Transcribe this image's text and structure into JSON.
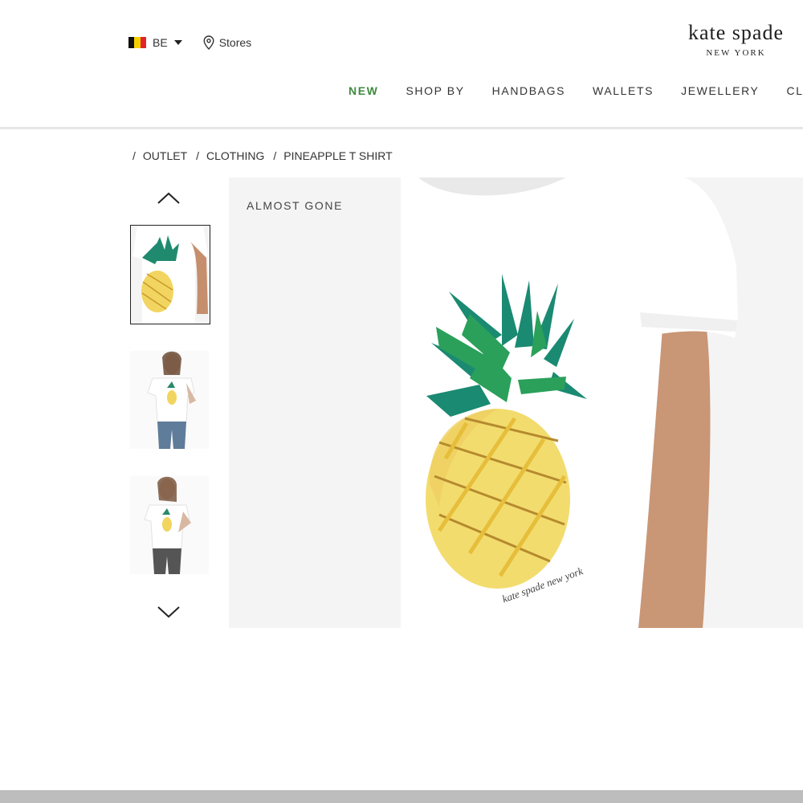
{
  "header": {
    "locale": {
      "code": "BE",
      "flag_colors": [
        "#111111",
        "#f5d000",
        "#e3232c"
      ]
    },
    "stores_label": "Stores",
    "logo": {
      "line1": "kate spade",
      "line2": "NEW YORK"
    },
    "nav": [
      {
        "label": "NEW",
        "highlight": true
      },
      {
        "label": "SHOP BY"
      },
      {
        "label": "HANDBAGS"
      },
      {
        "label": "WALLETS"
      },
      {
        "label": "JEWELLERY"
      },
      {
        "label": "CLOT"
      }
    ],
    "accent_color": "#3f8a3f"
  },
  "breadcrumb": [
    "OUTLET",
    "CLOTHING",
    "PINEAPPLE T SHIRT"
  ],
  "gallery": {
    "up_icon": "chevron-up-icon",
    "down_icon": "chevron-down-icon",
    "selected_index": 0,
    "thumbnails": [
      "thumbnail-front-view",
      "thumbnail-model-full",
      "thumbnail-model-pose"
    ]
  },
  "product": {
    "badge": "ALMOST GONE",
    "print_signature": "kate spade new york"
  }
}
